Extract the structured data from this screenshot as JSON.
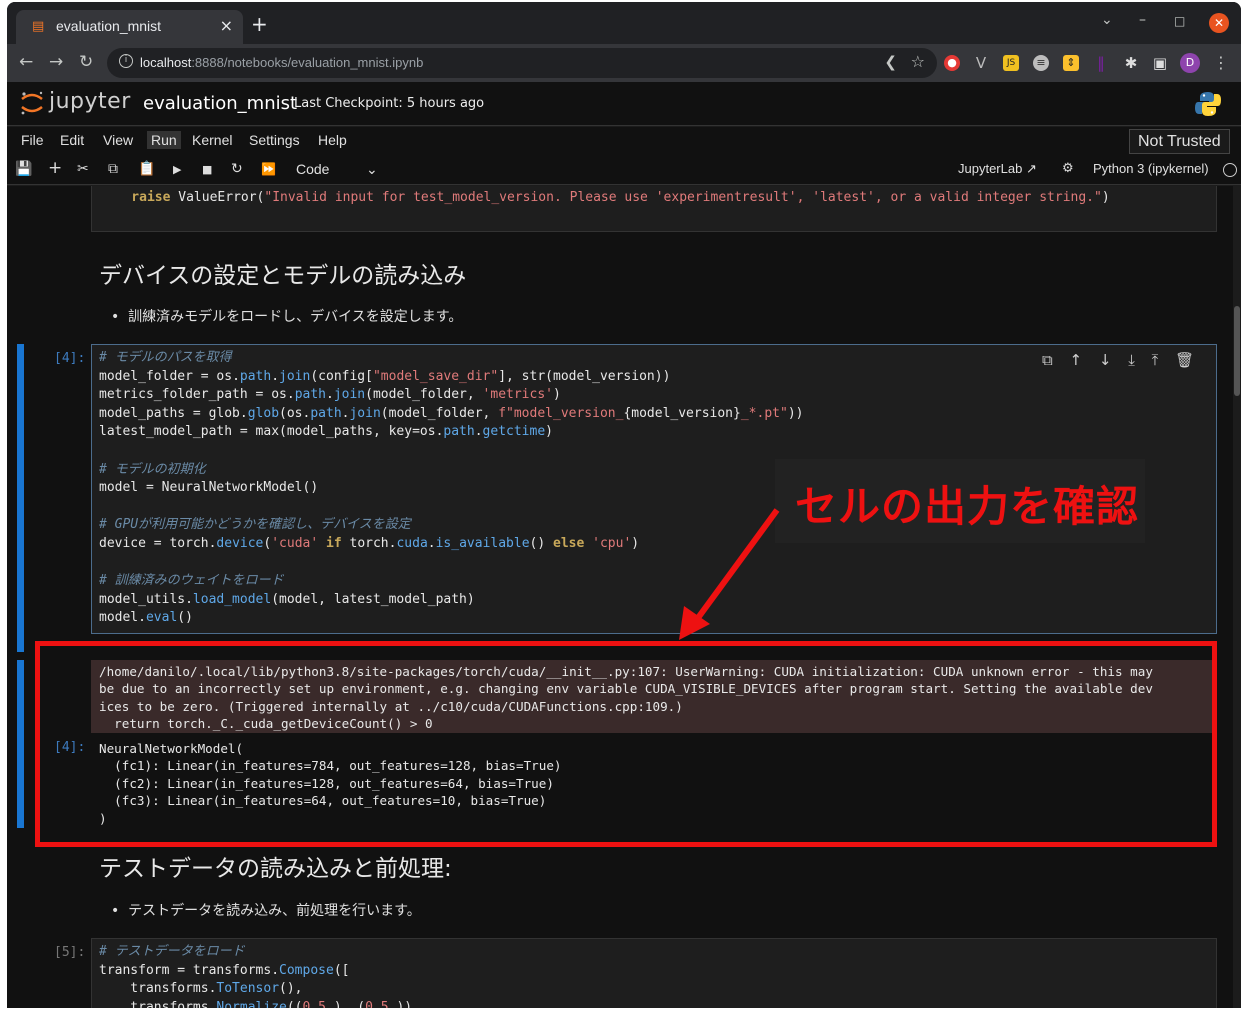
{
  "browser": {
    "tab_title": "evaluation_mnist",
    "tab_close": "×",
    "new_tab": "+",
    "url_host": "localhost",
    "url_rest": ":8888/notebooks/evaluation_mnist.ipynb",
    "avatar_letter": "D",
    "extensions": [
      {
        "name": "red-extension-icon",
        "color": "#e53935"
      },
      {
        "name": "v-extension-icon",
        "color": "#9e9e9e"
      },
      {
        "name": "js-extension-icon",
        "color": "#f0c020"
      },
      {
        "name": "list-extension-icon",
        "color": "#bdbdbd"
      },
      {
        "name": "yellow-extension-icon",
        "color": "#fbc02d"
      },
      {
        "name": "purple-extension-icon",
        "color": "#7b1fa2"
      }
    ]
  },
  "jupyter": {
    "logo_text": "jupyter",
    "notebook_name": "evaluation_mnist",
    "checkpoint": "Last Checkpoint: 5 hours ago",
    "menu": [
      "File",
      "Edit",
      "View",
      "Run",
      "Kernel",
      "Settings",
      "Help"
    ],
    "active_menu": "Run",
    "trust_label": "Not Trusted",
    "cell_type": "Code",
    "jupyterlab_label": "JupyterLab",
    "kernel_label": "Python 3 (ipykernel)"
  },
  "cells": {
    "prev_code_line": "    raise ValueError(\"Invalid input for test_model_version. Please use 'experimentresult', 'latest', or a valid integer string.\")",
    "heading1": "デバイスの設定とモデルの読み込み",
    "bullet1": "訓練済みモデルをロードし、デバイスを設定します。",
    "cell4_prompt": "[4]:",
    "cell4_out_prompt": "[4]:",
    "stderr": "/home/danilo/.local/lib/python3.8/site-packages/torch/cuda/__init__.py:107: UserWarning: CUDA initialization: CUDA unknown error - this may\nbe due to an incorrectly set up environment, e.g. changing env variable CUDA_VISIBLE_DEVICES after program start. Setting the available dev\nices to be zero. (Triggered internally at ../c10/cuda/CUDAFunctions.cpp:109.)\n  return torch._C._cuda_getDeviceCount() > 0",
    "output": "NeuralNetworkModel(\n  (fc1): Linear(in_features=784, out_features=128, bias=True)\n  (fc2): Linear(in_features=128, out_features=64, bias=True)\n  (fc3): Linear(in_features=64, out_features=10, bias=True)\n)",
    "heading2": "テストデータの読み込みと前処理:",
    "bullet2": "テストデータを読み込み、前処理を行います。",
    "cell5_prompt": "[5]:"
  },
  "annotation": {
    "callout_text": "セルの出力を確認",
    "color": "#ee1111"
  }
}
